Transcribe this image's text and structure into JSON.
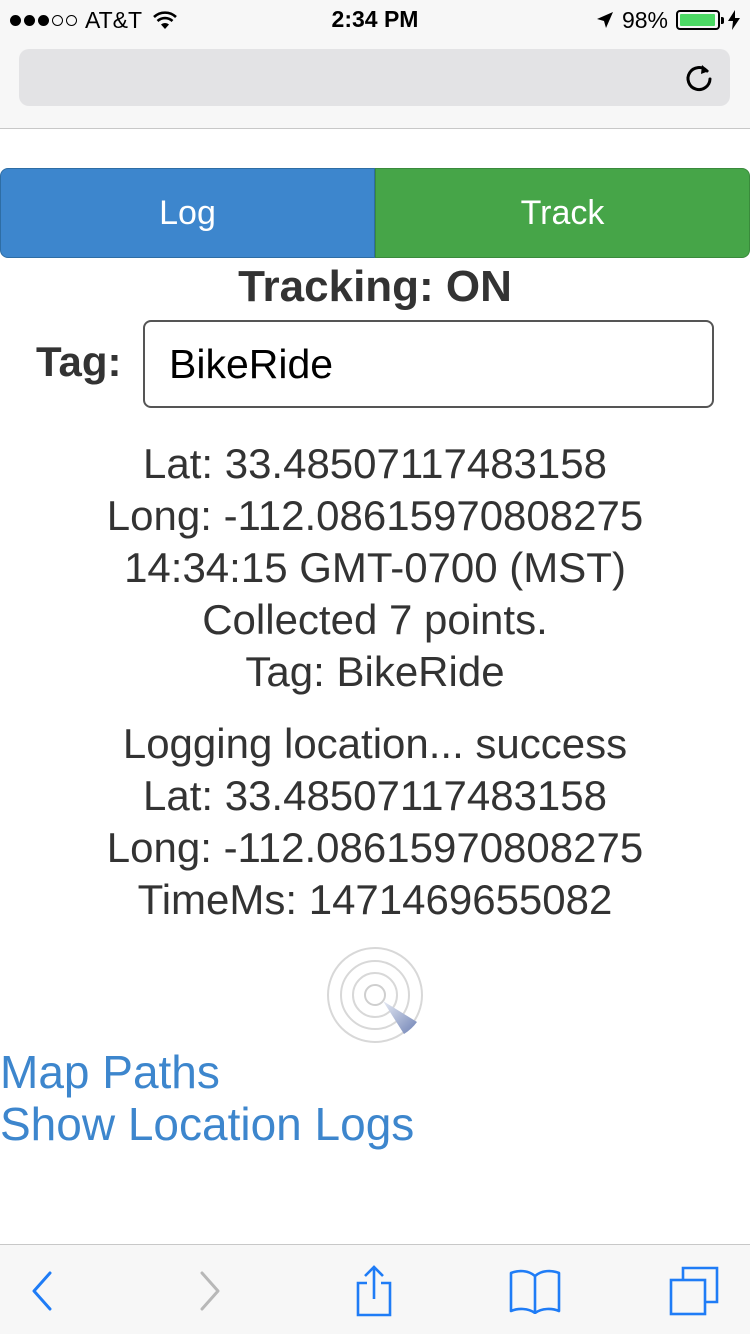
{
  "status_bar": {
    "carrier": "AT&T",
    "signal_bars_filled": 3,
    "signal_bars_total": 5,
    "time": "2:34 PM",
    "battery_percent": "98%",
    "battery_level": 0.98
  },
  "browser": {
    "url": "",
    "reload_icon": "reload-icon"
  },
  "controls": {
    "log_label": "Log",
    "track_label": "Track"
  },
  "tracking": {
    "status": "Tracking: ON",
    "tag_label": "Tag:",
    "tag_value": "BikeRide"
  },
  "current_fix": {
    "lat": "Lat: 33.4850711748315​8",
    "long": "Long: -112.08615970808275",
    "time": "14:34:15 GMT-0700 (MST)",
    "collected": "Collected 7 points.",
    "tag": "Tag: BikeRide"
  },
  "log_result": {
    "status": "Logging location... success",
    "lat": "Lat: 33.4850711748315​8",
    "long": "Long: -112.08615970808275",
    "time_ms": "TimeMs: 1471469655082"
  },
  "links": {
    "map_paths": "Map Paths",
    "show_logs": "Show Location Logs"
  },
  "colors": {
    "log_button": "#3d86cd",
    "track_button": "#46a548",
    "link": "#3d86cd",
    "toolbar_icon": "#1f7cf6"
  },
  "toolbar": {
    "icons": [
      "back-icon",
      "forward-icon",
      "share-icon",
      "bookmarks-icon",
      "tabs-icon"
    ]
  }
}
